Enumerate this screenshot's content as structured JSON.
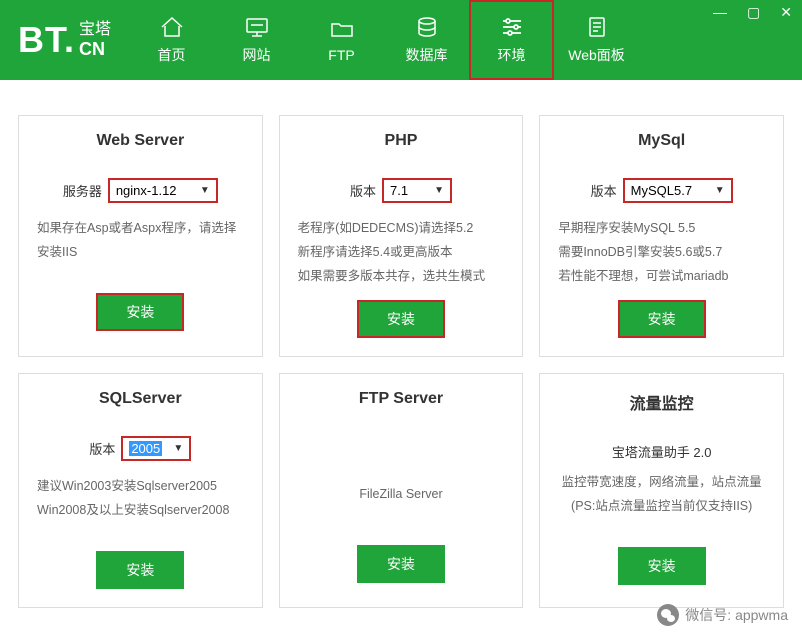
{
  "logo": {
    "bt": "BT",
    "dot": ".",
    "top": "宝塔",
    "bot": "CN"
  },
  "nav": [
    {
      "label": "首页"
    },
    {
      "label": "网站"
    },
    {
      "label": "FTP"
    },
    {
      "label": "数据库"
    },
    {
      "label": "环境"
    },
    {
      "label": "Web面板"
    }
  ],
  "cards": {
    "web": {
      "title": "Web Server",
      "field_label": "服务器",
      "selected": "nginx-1.12",
      "desc": "如果存在Asp或者Aspx程序，请选择安装IIS",
      "btn": "安装"
    },
    "php": {
      "title": "PHP",
      "field_label": "版本",
      "selected": "7.1",
      "desc1": "老程序(如DEDECMS)请选择5.2",
      "desc2": "新程序请选择5.4或更高版本",
      "desc3": "如果需要多版本共存，选共生模式",
      "btn": "安装"
    },
    "mysql": {
      "title": "MySql",
      "field_label": "版本",
      "selected": "MySQL5.7",
      "desc1": "早期程序安装MySQL 5.5",
      "desc2": "需要InnoDB引擎安装5.6或5.7",
      "desc3": "若性能不理想，可尝试mariadb",
      "btn": "安装"
    },
    "sql": {
      "title": "SQLServer",
      "field_label": "版本",
      "selected": "2005",
      "desc1": "建议Win2003安装Sqlserver2005",
      "desc2": "Win2008及以上安装Sqlserver2008",
      "btn": "安装"
    },
    "ftp": {
      "title": "FTP Server",
      "desc": "FileZilla Server",
      "btn": "安装"
    },
    "traffic": {
      "title": "流量监控",
      "subtitle": "宝塔流量助手 2.0",
      "desc": "监控带宽速度，网络流量，站点流量(PS:站点流量监控当前仅支持IIS)",
      "btn": "安装"
    }
  },
  "footer": {
    "label": "微信号",
    "value": "appwma"
  }
}
